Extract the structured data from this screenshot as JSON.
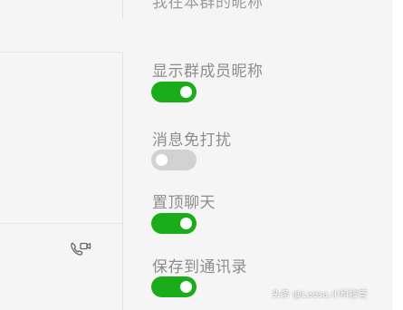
{
  "header": {
    "truncated_label": "我在本群的昵称"
  },
  "settings": [
    {
      "label": "显示群成员昵称",
      "state": "on"
    },
    {
      "label": "消息免打扰",
      "state": "off"
    },
    {
      "label": "置顶聊天",
      "state": "on"
    },
    {
      "label": "保存到通讯录",
      "state": "on"
    }
  ],
  "sidebar": {
    "video_call_icon": "video-call-icon"
  },
  "watermark": {
    "text": "头条 @Leesa.小科技管"
  },
  "colors": {
    "toggle_on": "#1aad19",
    "toggle_off": "#d2d2d2",
    "label_text": "#8d8d8d",
    "background": "#f5f5f5"
  }
}
